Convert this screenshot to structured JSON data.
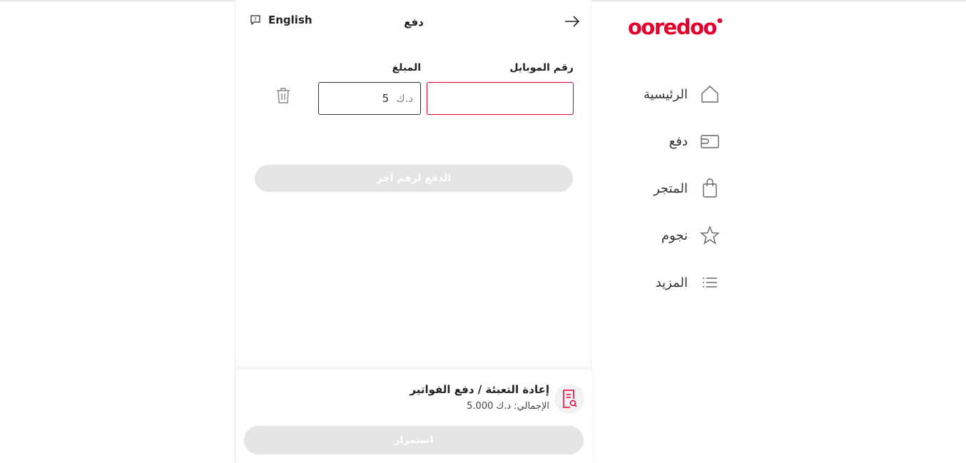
{
  "brand": {
    "logo_text": "ooredoo",
    "accent": "#e4002b"
  },
  "sidebar": {
    "items": [
      {
        "label": "الرئيسية",
        "icon": "home-icon"
      },
      {
        "label": "دفع",
        "icon": "wallet-icon"
      },
      {
        "label": "المتجر",
        "icon": "shopping-bag-icon"
      },
      {
        "label": "نجوم",
        "icon": "star-icon"
      },
      {
        "label": "المزيد",
        "icon": "menu-list-icon"
      }
    ]
  },
  "header": {
    "language": "English",
    "title": "دفع"
  },
  "form": {
    "mobile_label": "رقم الموبايل",
    "mobile_value": "",
    "amount_label": "المبلغ",
    "amount_currency": "د.ك",
    "amount_value": "5",
    "pay_other_label": "الدفع لرقم آخر"
  },
  "summary": {
    "title": "إعادة التعبئة / دفع الفواتير",
    "total": "الإجمالي: د.ك 5.000",
    "continue_label": "استمرار"
  }
}
